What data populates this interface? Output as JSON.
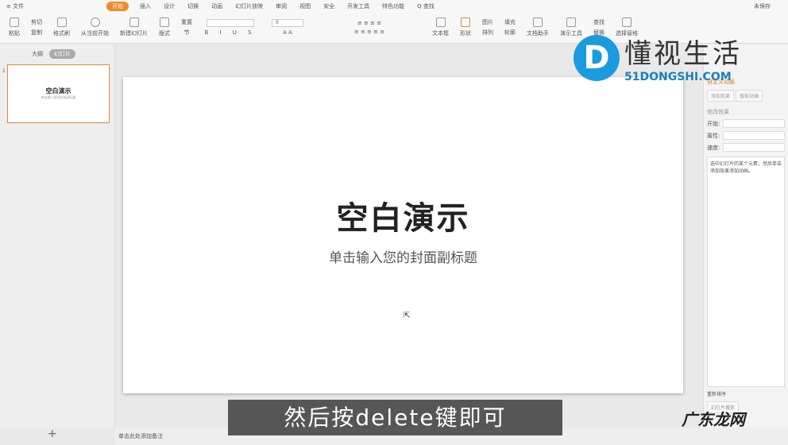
{
  "menubar": {
    "file": "≡ 文件",
    "items": [
      "开始",
      "插入",
      "设计",
      "切换",
      "动画",
      "幻灯片放映",
      "审阅",
      "视图",
      "安全",
      "开发工具",
      "特色功能"
    ],
    "search": "Q 查找",
    "unsaved": "未保存"
  },
  "toolbar": {
    "paste": "粘贴",
    "cut": "剪切",
    "copy": "复制",
    "format_painter": "格式刷",
    "from_current": "从当前开始",
    "new_slide": "新建幻灯片",
    "layout": "版式",
    "reset": "重置",
    "section": "节",
    "font_size": "0",
    "textbox": "文本框",
    "shape": "形状",
    "picture": "图片",
    "arrange": "排列",
    "fill": "填充",
    "outline": "轮廓",
    "doc_helper": "文档助手",
    "presentation_tools": "演示工具",
    "find": "查找",
    "replace": "替换",
    "select_pane": "选择窗格"
  },
  "left_panel": {
    "tab_outline": "大纲",
    "tab_slides": "幻灯片",
    "slide_number": "1",
    "thumb_title": "空白演示",
    "thumb_subtitle": "单击输入您的封面副标题"
  },
  "slide": {
    "title": "空白演示",
    "subtitle": "单击输入您的封面副标题"
  },
  "right_panel": {
    "header": "自定义动画",
    "add_effect": "添加效果",
    "smart_anim": "智能动画",
    "modify": "修改效果",
    "start": "开始:",
    "property": "属性:",
    "speed": "速度:",
    "hint": "选中幻灯片的某个元素，然后单击添加效果添加动画。",
    "reorder": "重新排序",
    "slideshow": "幻灯片播放"
  },
  "status": {
    "notes": "单击此处添加备注",
    "add_slide": "+"
  },
  "caption": "然后按delete键即可",
  "watermark": {
    "cn": "懂视生活",
    "en": "51DONGSHI.COM",
    "site": "广东龙网"
  }
}
